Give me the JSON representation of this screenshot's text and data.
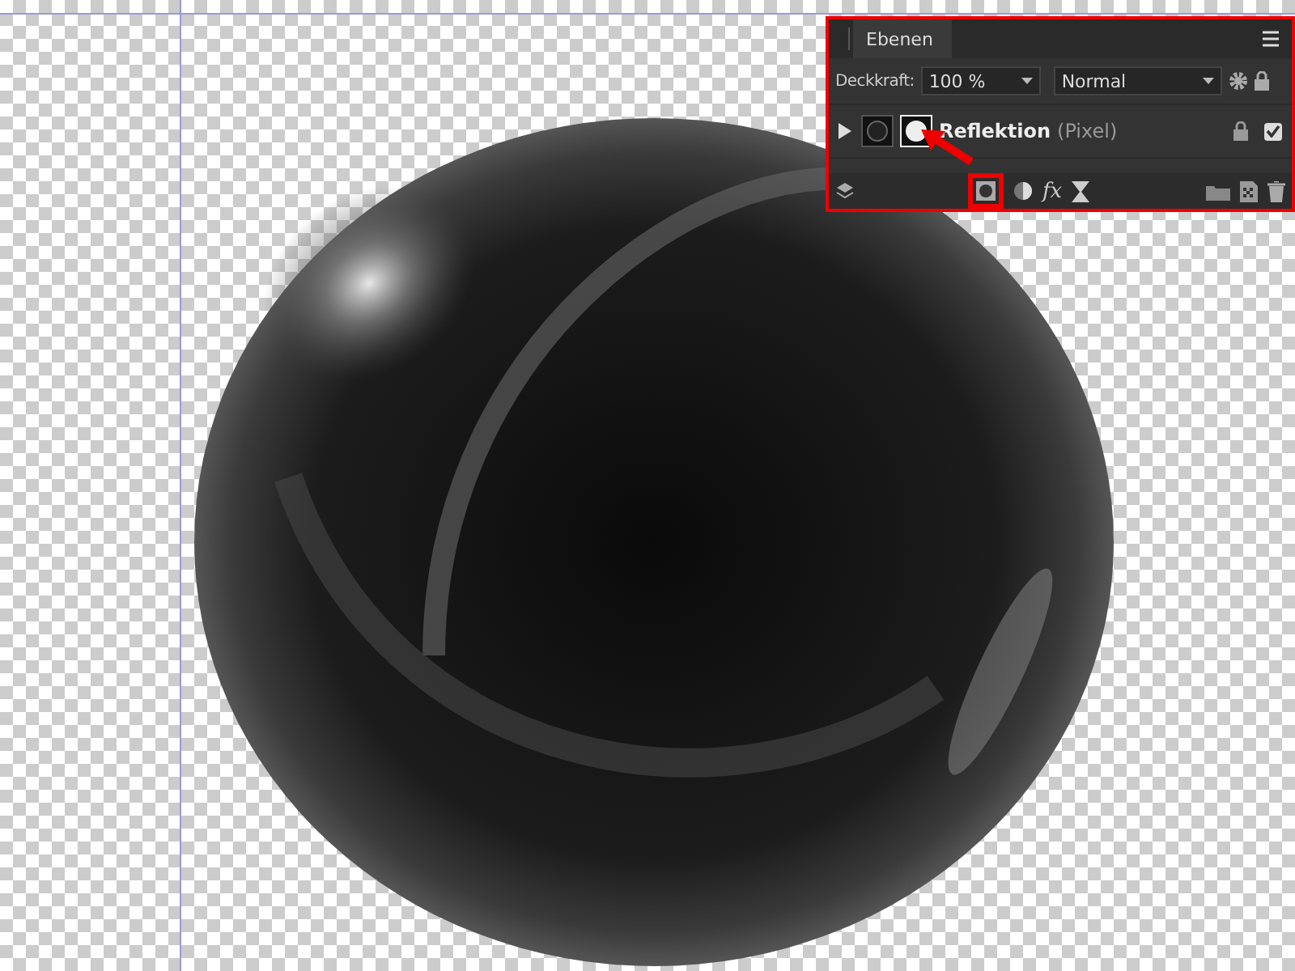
{
  "layers_panel": {
    "tab": "Ebenen",
    "opacity_label": "Deckkraft:",
    "opacity_value": "100 %",
    "blend_mode": "Normal",
    "layers": [
      {
        "name": "Reflektion",
        "type": "(Pixel)",
        "expanded": false,
        "visible": true
      }
    ],
    "fx_label": "fx",
    "highlighted": true
  }
}
